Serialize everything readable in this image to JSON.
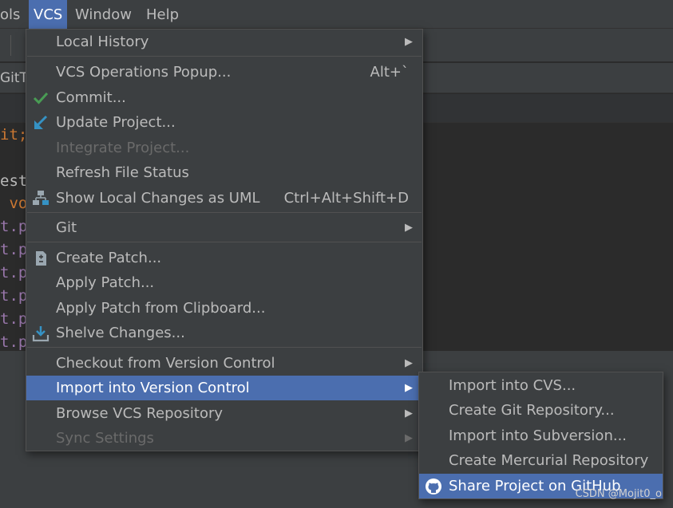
{
  "menubar": {
    "items": [
      {
        "label": "ols"
      },
      {
        "label": "VCS"
      },
      {
        "label": "Window"
      },
      {
        "label": "Help"
      }
    ]
  },
  "background": {
    "tab_label": "GitT",
    "code_lines": [
      "it;",
      "est",
      " vo",
      "t.p",
      "t.p",
      "t.p",
      "t.p",
      "t.p",
      "t.p"
    ]
  },
  "vcs_menu": {
    "local_history": "Local History",
    "vcs_operations_popup": "VCS Operations Popup...",
    "vcs_operations_shortcut": "Alt+`",
    "commit": "Commit...",
    "update_project": "Update Project...",
    "integrate_project": "Integrate Project...",
    "refresh_file_status": "Refresh File Status",
    "show_local_changes_uml": "Show Local Changes as UML",
    "show_local_changes_shortcut": "Ctrl+Alt+Shift+D",
    "git": "Git",
    "create_patch": "Create Patch...",
    "apply_patch": "Apply Patch...",
    "apply_patch_clipboard": "Apply Patch from Clipboard...",
    "shelve_changes": "Shelve Changes...",
    "checkout_vc": "Checkout from Version Control",
    "import_vc": "Import into Version Control",
    "browse_vcs_repo": "Browse VCS Repository",
    "sync_settings": "Sync Settings"
  },
  "import_submenu": {
    "import_cvs": "Import into CVS...",
    "create_git_repo": "Create Git Repository...",
    "import_subversion": "Import into Subversion...",
    "create_mercurial_repo": "Create Mercurial Repository",
    "share_github": "Share Project on GitHub"
  },
  "watermark": "CSDN @Mojit0_o",
  "colors": {
    "menu_bg": "#3c3f41",
    "highlight": "#4b6eaf",
    "text": "#bbbbbb",
    "disabled_text": "#6a6a6a",
    "commit_check": "#499c54",
    "update_arrow": "#3592c4"
  }
}
